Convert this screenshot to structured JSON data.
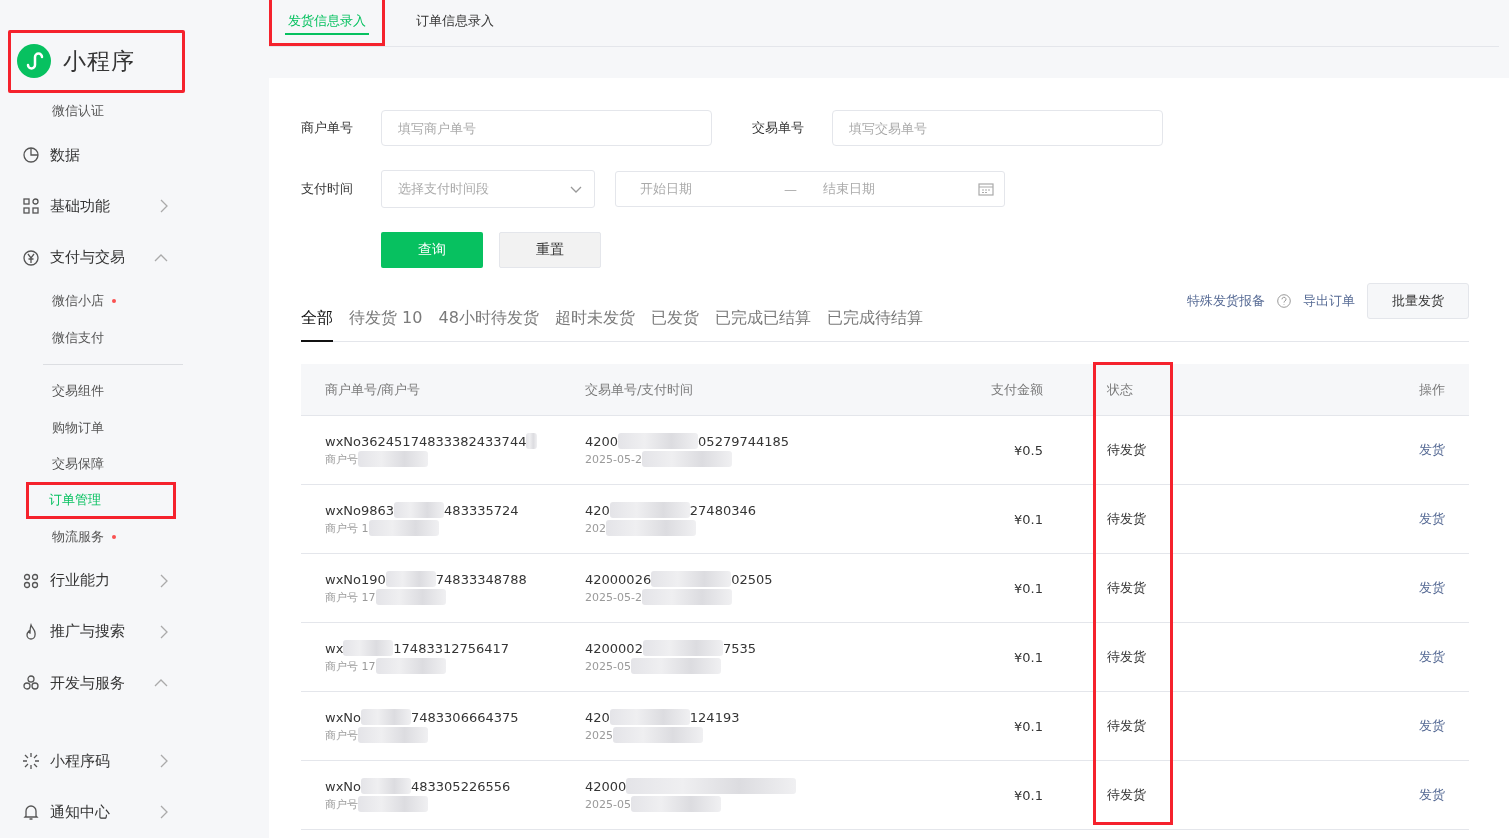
{
  "sidebar": {
    "brand": {
      "title": "小程序",
      "highlighted": true
    },
    "items": [
      {
        "kind": "sub",
        "label": "微信认证",
        "dot": false,
        "selected": false,
        "highlighted": false
      },
      {
        "kind": "group",
        "label": "数据"
      },
      {
        "kind": "group",
        "label": "基础功能",
        "expanded": false
      },
      {
        "kind": "group",
        "label": "支付与交易",
        "expanded": true
      },
      {
        "kind": "sub",
        "label": "微信小店",
        "dot": true,
        "selected": false,
        "highlighted": false
      },
      {
        "kind": "sub",
        "label": "微信支付",
        "dot": false,
        "selected": false,
        "highlighted": false
      },
      {
        "kind": "divider"
      },
      {
        "kind": "sub",
        "label": "交易组件",
        "dot": false,
        "selected": false,
        "highlighted": false
      },
      {
        "kind": "sub",
        "label": "购物订单",
        "dot": false,
        "selected": false,
        "highlighted": false
      },
      {
        "kind": "sub",
        "label": "交易保障",
        "dot": false,
        "selected": false,
        "highlighted": false
      },
      {
        "kind": "sub",
        "label": "订单管理",
        "dot": false,
        "selected": true,
        "highlighted": true
      },
      {
        "kind": "sub",
        "label": "物流服务",
        "dot": true,
        "selected": false,
        "highlighted": false
      },
      {
        "kind": "group",
        "label": "行业能力",
        "expanded": false
      },
      {
        "kind": "group",
        "label": "推广与搜索",
        "expanded": false
      },
      {
        "kind": "group",
        "label": "开发与服务",
        "expanded": true
      },
      {
        "kind": "gap"
      },
      {
        "kind": "group",
        "label": "小程序码",
        "expanded": false
      },
      {
        "kind": "group",
        "label": "通知中心",
        "expanded": false
      }
    ]
  },
  "top_tabs": [
    {
      "label": "发货信息录入",
      "selected": true,
      "highlighted": true
    },
    {
      "label": "订单信息录入",
      "selected": false,
      "highlighted": false
    }
  ],
  "filters": {
    "merchant_no": {
      "label": "商户单号",
      "placeholder": "填写商户单号"
    },
    "trade_no": {
      "label": "交易单号",
      "placeholder": "填写交易单号"
    },
    "pay_time": {
      "label": "支付时间",
      "select_placeholder": "选择支付时间段",
      "start_placeholder": "开始日期",
      "separator": "—",
      "end_placeholder": "结束日期"
    },
    "query_button": "查询",
    "reset_button": "重置"
  },
  "status_tabs": [
    {
      "label": "全部",
      "selected": true
    },
    {
      "label": "待发货 10",
      "selected": false
    },
    {
      "label": "48小时待发货",
      "selected": false
    },
    {
      "label": "超时未发货",
      "selected": false
    },
    {
      "label": "已发货",
      "selected": false
    },
    {
      "label": "已完成已结算",
      "selected": false
    },
    {
      "label": "已完成待结算",
      "selected": false
    }
  ],
  "actions": {
    "special_link": "特殊发货报备",
    "export_link": "导出订单",
    "batch_button": "批量发货"
  },
  "table": {
    "columns": [
      "商户单号/商户号",
      "交易单号/支付时间",
      "支付金额",
      "状态",
      "操作"
    ],
    "status_column_highlighted": true,
    "rows": [
      {
        "order_no": "wxNo36245174833382433744",
        "order_tail": "",
        "merchant": "商户号",
        "trade_no": "4200",
        "trade_tail": "05279744185",
        "pay_time": "2025-05-2",
        "amount": "¥0.5",
        "status": "待发货",
        "action": "发货"
      },
      {
        "order_no": "wxNo9863",
        "order_tail": "483335724",
        "merchant": "商户号 1",
        "trade_no": "420",
        "trade_tail": "27480346",
        "pay_time": "202",
        "amount": "¥0.1",
        "status": "待发货",
        "action": "发货"
      },
      {
        "order_no": "wxNo190",
        "order_tail": "74833348788",
        "merchant": "商户号 17",
        "trade_no": "42000026",
        "trade_tail": "02505",
        "pay_time": "2025-05-2",
        "amount": "¥0.1",
        "status": "待发货",
        "action": "发货"
      },
      {
        "order_no": "wx",
        "order_tail": "17483312756417",
        "merchant": "商户号 17",
        "trade_no": "4200002",
        "trade_tail": "7535",
        "pay_time": "2025-05",
        "amount": "¥0.1",
        "status": "待发货",
        "action": "发货"
      },
      {
        "order_no": "wxNo",
        "order_tail": "7483306664375",
        "merchant": "商户号",
        "trade_no": "420",
        "trade_tail": "124193",
        "pay_time": "2025",
        "amount": "¥0.1",
        "status": "待发货",
        "action": "发货"
      },
      {
        "order_no": "wxNo",
        "order_tail": "483305226556",
        "merchant": "商户号",
        "trade_no": "42000",
        "trade_tail": "",
        "pay_time": "2025-05",
        "amount": "¥0.1",
        "status": "待发货",
        "action": "发货"
      }
    ]
  }
}
